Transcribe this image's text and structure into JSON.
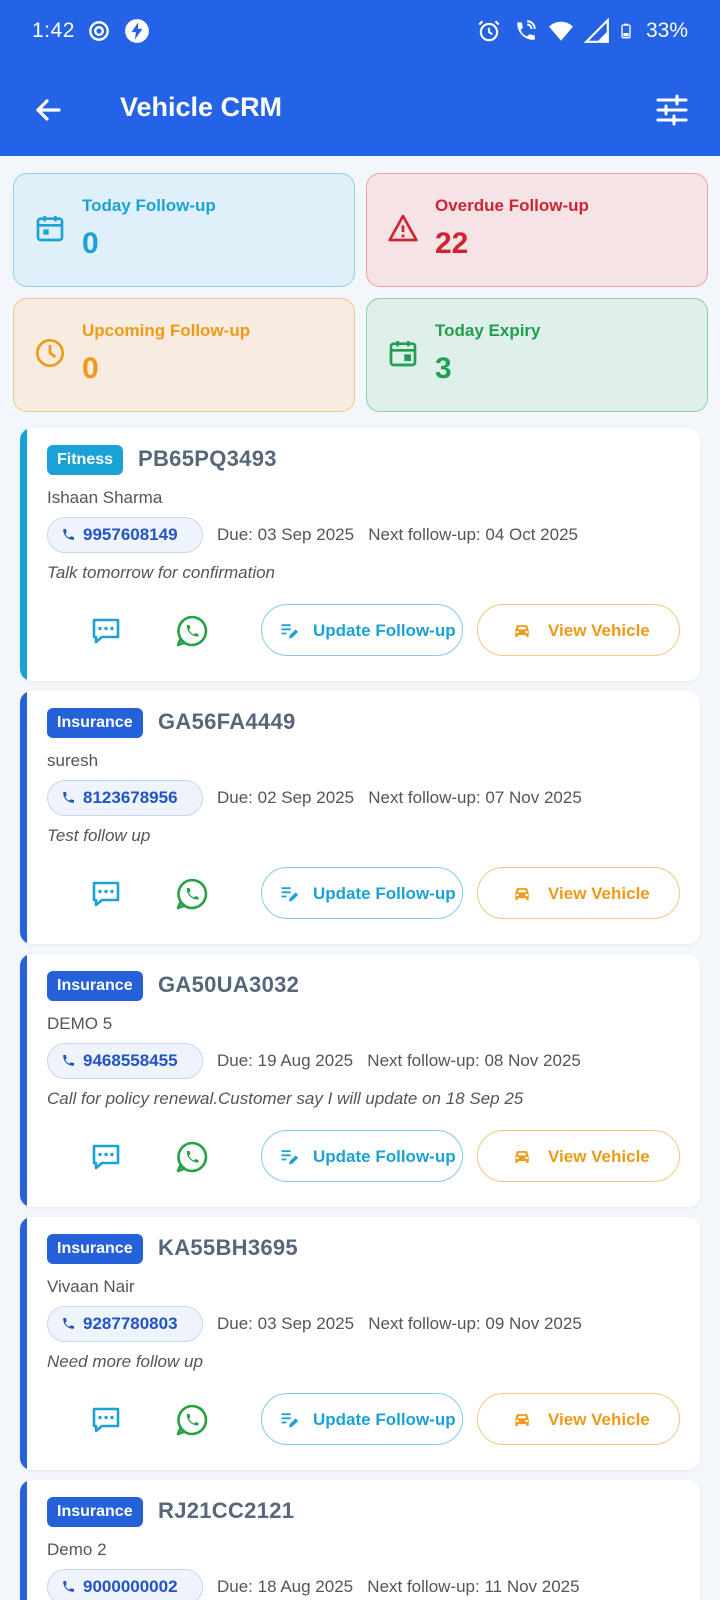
{
  "status_bar": {
    "time": "1:42",
    "battery": "33%"
  },
  "app_bar": {
    "title": "Vehicle CRM"
  },
  "stats": {
    "today": {
      "label": "Today Follow-up",
      "value": "0"
    },
    "overdue": {
      "label": "Overdue Follow-up",
      "value": "22"
    },
    "upcoming": {
      "label": "Upcoming Follow-up",
      "value": "0"
    },
    "expiry": {
      "label": "Today Expiry",
      "value": "3"
    }
  },
  "buttons": {
    "update_label": "Update Follow-up",
    "view_label": "View Vehicle"
  },
  "colors": {
    "primary": "#2563e6",
    "fitness": "#1aa2d6",
    "insurance": "#2562d9",
    "whatsapp": "#25a244",
    "overdue": "#cf2431",
    "upcoming": "#ee9a16",
    "expiry": "#1ea04e"
  },
  "records": [
    {
      "type": "Fitness",
      "plate": "PB65PQ3493",
      "customer": "Ishaan Sharma",
      "phone": "9957608149",
      "due_next": "Due: 03 Sep 2025   Next follow-up: 04 Oct 2025",
      "note": "Talk tomorrow for confirmation"
    },
    {
      "type": "Insurance",
      "plate": "GA56FA4449",
      "customer": "suresh",
      "phone": "8123678956",
      "due_next": "Due: 02 Sep 2025   Next follow-up: 07 Nov 2025",
      "note": "Test follow up"
    },
    {
      "type": "Insurance",
      "plate": "GA50UA3032",
      "customer": "DEMO 5",
      "phone": "9468558455",
      "due_next": "Due: 19 Aug 2025   Next follow-up: 08 Nov 2025",
      "note": "Call for policy renewal.Customer say I will update on 18 Sep 25"
    },
    {
      "type": "Insurance",
      "plate": "KA55BH3695",
      "customer": "Vivaan Nair",
      "phone": "9287780803",
      "due_next": "Due: 03 Sep 2025   Next follow-up: 09 Nov 2025",
      "note": "Need more follow up"
    },
    {
      "type": "Insurance",
      "plate": "RJ21CC2121",
      "customer": "Demo 2",
      "phone": "9000000002",
      "due_next": "Due: 18 Aug 2025   Next follow-up: 11 Nov 2025",
      "note": ""
    }
  ]
}
